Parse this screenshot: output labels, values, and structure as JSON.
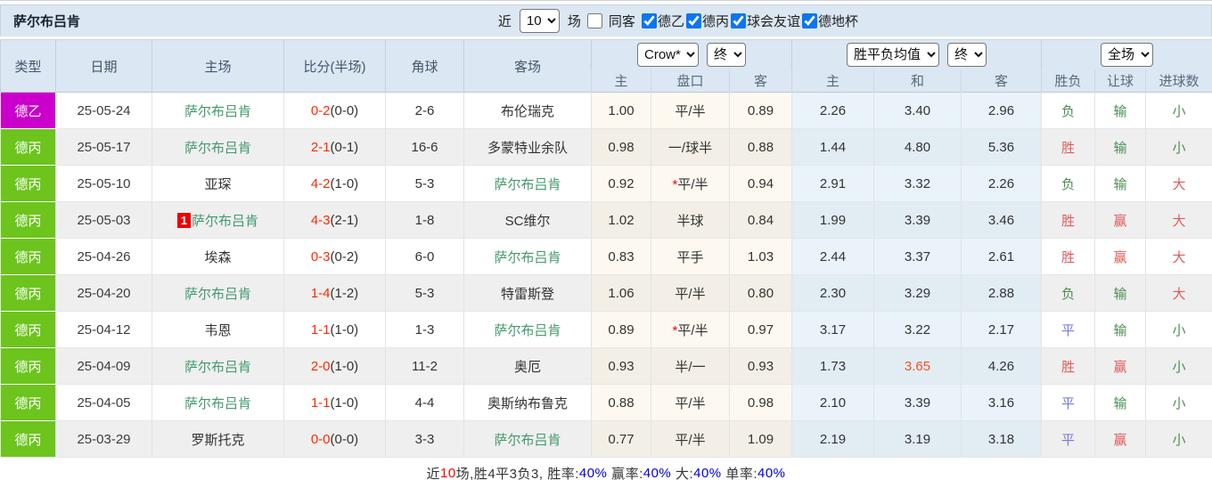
{
  "colors": {
    "red": "#e05a5a",
    "green": "#4e8e52",
    "blue": "#7878e8",
    "team_green": "#43996d",
    "score_red": "#ff2a00",
    "hot_odds": "#f4511e",
    "badge_red": "#ee0000",
    "type_de2": "#cc00cc",
    "type_de3": "#6cc41d",
    "stat_blue": "#0000dd",
    "stat_red": "#ff0000"
  },
  "filter_bar": {
    "team_title": "萨尔布吕肯",
    "recent_label": "近",
    "recent_value": "10",
    "matches_label": "场",
    "same_venue_label": "同客",
    "same_venue_checked": false,
    "leagues": [
      {
        "label": "德乙",
        "checked": true
      },
      {
        "label": "德丙",
        "checked": true
      },
      {
        "label": "球会友谊",
        "checked": true
      },
      {
        "label": "德地杯",
        "checked": true
      }
    ]
  },
  "table": {
    "headers": {
      "type": "类型",
      "date": "日期",
      "home": "主场",
      "score": "比分(半场)",
      "corners": "角球",
      "away": "客场",
      "sub_home1": "主",
      "sub_handicap": "盘口",
      "sub_away1": "客",
      "sub_home2": "主",
      "sub_draw": "和",
      "sub_away2": "客",
      "sub_wdl": "胜负",
      "sub_letball": "让球",
      "sub_goals": "进球数"
    },
    "selects": {
      "bookmaker": "Crow*",
      "bookmaker_time": "终",
      "avg": "胜平负均值",
      "avg_time": "终",
      "scope": "全场"
    },
    "rows": [
      {
        "type": "德乙",
        "type_key": "de2",
        "date": "25-05-24",
        "home": "萨尔布吕肯",
        "home_is_focus": true,
        "badge": "",
        "score": "0-2",
        "half": "(0-0)",
        "corners": "2-6",
        "away": "布伦瑞克",
        "away_is_focus": false,
        "crow_home": "1.00",
        "handicap": "平/半",
        "star": false,
        "crow_away": "0.89",
        "avg_home": "2.26",
        "avg_draw": "3.40",
        "avg_away": "2.96",
        "draw_hot": false,
        "wdl": "负",
        "wdl_c": "green",
        "let": "输",
        "let_c": "green",
        "goal": "小",
        "goal_c": "green"
      },
      {
        "type": "德丙",
        "type_key": "de3",
        "date": "25-05-17",
        "home": "萨尔布吕肯",
        "home_is_focus": true,
        "badge": "",
        "score": "2-1",
        "half": "(0-1)",
        "corners": "16-6",
        "away": "多蒙特业余队",
        "away_is_focus": false,
        "crow_home": "0.98",
        "handicap": "一/球半",
        "star": false,
        "crow_away": "0.88",
        "avg_home": "1.44",
        "avg_draw": "4.80",
        "avg_away": "5.36",
        "draw_hot": false,
        "wdl": "胜",
        "wdl_c": "red",
        "let": "输",
        "let_c": "green",
        "goal": "小",
        "goal_c": "green"
      },
      {
        "type": "德丙",
        "type_key": "de3",
        "date": "25-05-10",
        "home": "亚琛",
        "home_is_focus": false,
        "badge": "",
        "score": "4-2",
        "half": "(1-0)",
        "corners": "5-3",
        "away": "萨尔布吕肯",
        "away_is_focus": true,
        "crow_home": "0.92",
        "handicap": "平/半",
        "star": true,
        "crow_away": "0.94",
        "avg_home": "2.91",
        "avg_draw": "3.32",
        "avg_away": "2.26",
        "draw_hot": false,
        "wdl": "负",
        "wdl_c": "green",
        "let": "输",
        "let_c": "green",
        "goal": "大",
        "goal_c": "red"
      },
      {
        "type": "德丙",
        "type_key": "de3",
        "date": "25-05-03",
        "home": "萨尔布吕肯",
        "home_is_focus": true,
        "badge": "1",
        "score": "4-3",
        "half": "(2-1)",
        "corners": "1-8",
        "away": "SC维尔",
        "away_is_focus": false,
        "crow_home": "1.02",
        "handicap": "半球",
        "star": false,
        "crow_away": "0.84",
        "avg_home": "1.99",
        "avg_draw": "3.39",
        "avg_away": "3.46",
        "draw_hot": false,
        "wdl": "胜",
        "wdl_c": "red",
        "let": "赢",
        "let_c": "red",
        "goal": "大",
        "goal_c": "red"
      },
      {
        "type": "德丙",
        "type_key": "de3",
        "date": "25-04-26",
        "home": "埃森",
        "home_is_focus": false,
        "badge": "",
        "score": "0-3",
        "half": "(0-2)",
        "corners": "6-0",
        "away": "萨尔布吕肯",
        "away_is_focus": true,
        "crow_home": "0.83",
        "handicap": "平手",
        "star": false,
        "crow_away": "1.03",
        "avg_home": "2.44",
        "avg_draw": "3.37",
        "avg_away": "2.61",
        "draw_hot": false,
        "wdl": "胜",
        "wdl_c": "red",
        "let": "赢",
        "let_c": "red",
        "goal": "大",
        "goal_c": "red"
      },
      {
        "type": "德丙",
        "type_key": "de3",
        "date": "25-04-20",
        "home": "萨尔布吕肯",
        "home_is_focus": true,
        "badge": "",
        "score": "1-4",
        "half": "(1-2)",
        "corners": "5-3",
        "away": "特雷斯登",
        "away_is_focus": false,
        "crow_home": "1.06",
        "handicap": "平/半",
        "star": false,
        "crow_away": "0.80",
        "avg_home": "2.30",
        "avg_draw": "3.29",
        "avg_away": "2.88",
        "draw_hot": false,
        "wdl": "负",
        "wdl_c": "green",
        "let": "输",
        "let_c": "green",
        "goal": "大",
        "goal_c": "red"
      },
      {
        "type": "德丙",
        "type_key": "de3",
        "date": "25-04-12",
        "home": "韦恩",
        "home_is_focus": false,
        "badge": "",
        "score": "1-1",
        "half": "(1-0)",
        "corners": "1-3",
        "away": "萨尔布吕肯",
        "away_is_focus": true,
        "crow_home": "0.89",
        "handicap": "平/半",
        "star": true,
        "crow_away": "0.97",
        "avg_home": "3.17",
        "avg_draw": "3.22",
        "avg_away": "2.17",
        "draw_hot": false,
        "wdl": "平",
        "wdl_c": "blue",
        "let": "输",
        "let_c": "green",
        "goal": "小",
        "goal_c": "green"
      },
      {
        "type": "德丙",
        "type_key": "de3",
        "date": "25-04-09",
        "home": "萨尔布吕肯",
        "home_is_focus": true,
        "badge": "",
        "score": "2-0",
        "half": "(1-0)",
        "corners": "11-2",
        "away": "奥厄",
        "away_is_focus": false,
        "crow_home": "0.93",
        "handicap": "半/一",
        "star": false,
        "crow_away": "0.93",
        "avg_home": "1.73",
        "avg_draw": "3.65",
        "avg_away": "4.26",
        "draw_hot": true,
        "wdl": "胜",
        "wdl_c": "red",
        "let": "赢",
        "let_c": "red",
        "goal": "小",
        "goal_c": "green"
      },
      {
        "type": "德丙",
        "type_key": "de3",
        "date": "25-04-05",
        "home": "萨尔布吕肯",
        "home_is_focus": true,
        "badge": "",
        "score": "1-1",
        "half": "(1-0)",
        "corners": "4-4",
        "away": "奥斯纳布鲁克",
        "away_is_focus": false,
        "crow_home": "0.88",
        "handicap": "平/半",
        "star": false,
        "crow_away": "0.98",
        "avg_home": "2.10",
        "avg_draw": "3.39",
        "avg_away": "3.16",
        "draw_hot": false,
        "wdl": "平",
        "wdl_c": "blue",
        "let": "输",
        "let_c": "green",
        "goal": "小",
        "goal_c": "green"
      },
      {
        "type": "德丙",
        "type_key": "de3",
        "date": "25-03-29",
        "home": "罗斯托克",
        "home_is_focus": false,
        "badge": "",
        "score": "0-0",
        "half": "(0-0)",
        "corners": "3-3",
        "away": "萨尔布吕肯",
        "away_is_focus": true,
        "crow_home": "0.77",
        "handicap": "平/半",
        "star": false,
        "crow_away": "1.09",
        "avg_home": "2.19",
        "avg_draw": "3.19",
        "avg_away": "3.18",
        "draw_hot": false,
        "wdl": "平",
        "wdl_c": "blue",
        "let": "赢",
        "let_c": "red",
        "goal": "小",
        "goal_c": "green"
      }
    ]
  },
  "footer": {
    "segments": [
      {
        "text": "近",
        "color": "#333333"
      },
      {
        "text": "10",
        "color": "#ff0000"
      },
      {
        "text": "场,胜4平3负3, 胜率:",
        "color": "#333333"
      },
      {
        "text": "40%",
        "color": "#0000dd"
      },
      {
        "text": " 赢率:",
        "color": "#333333"
      },
      {
        "text": "40%",
        "color": "#0000dd"
      },
      {
        "text": " 大:",
        "color": "#333333"
      },
      {
        "text": "40%",
        "color": "#0000dd"
      },
      {
        "text": " 单率:",
        "color": "#333333"
      },
      {
        "text": "40%",
        "color": "#0000dd"
      }
    ]
  }
}
